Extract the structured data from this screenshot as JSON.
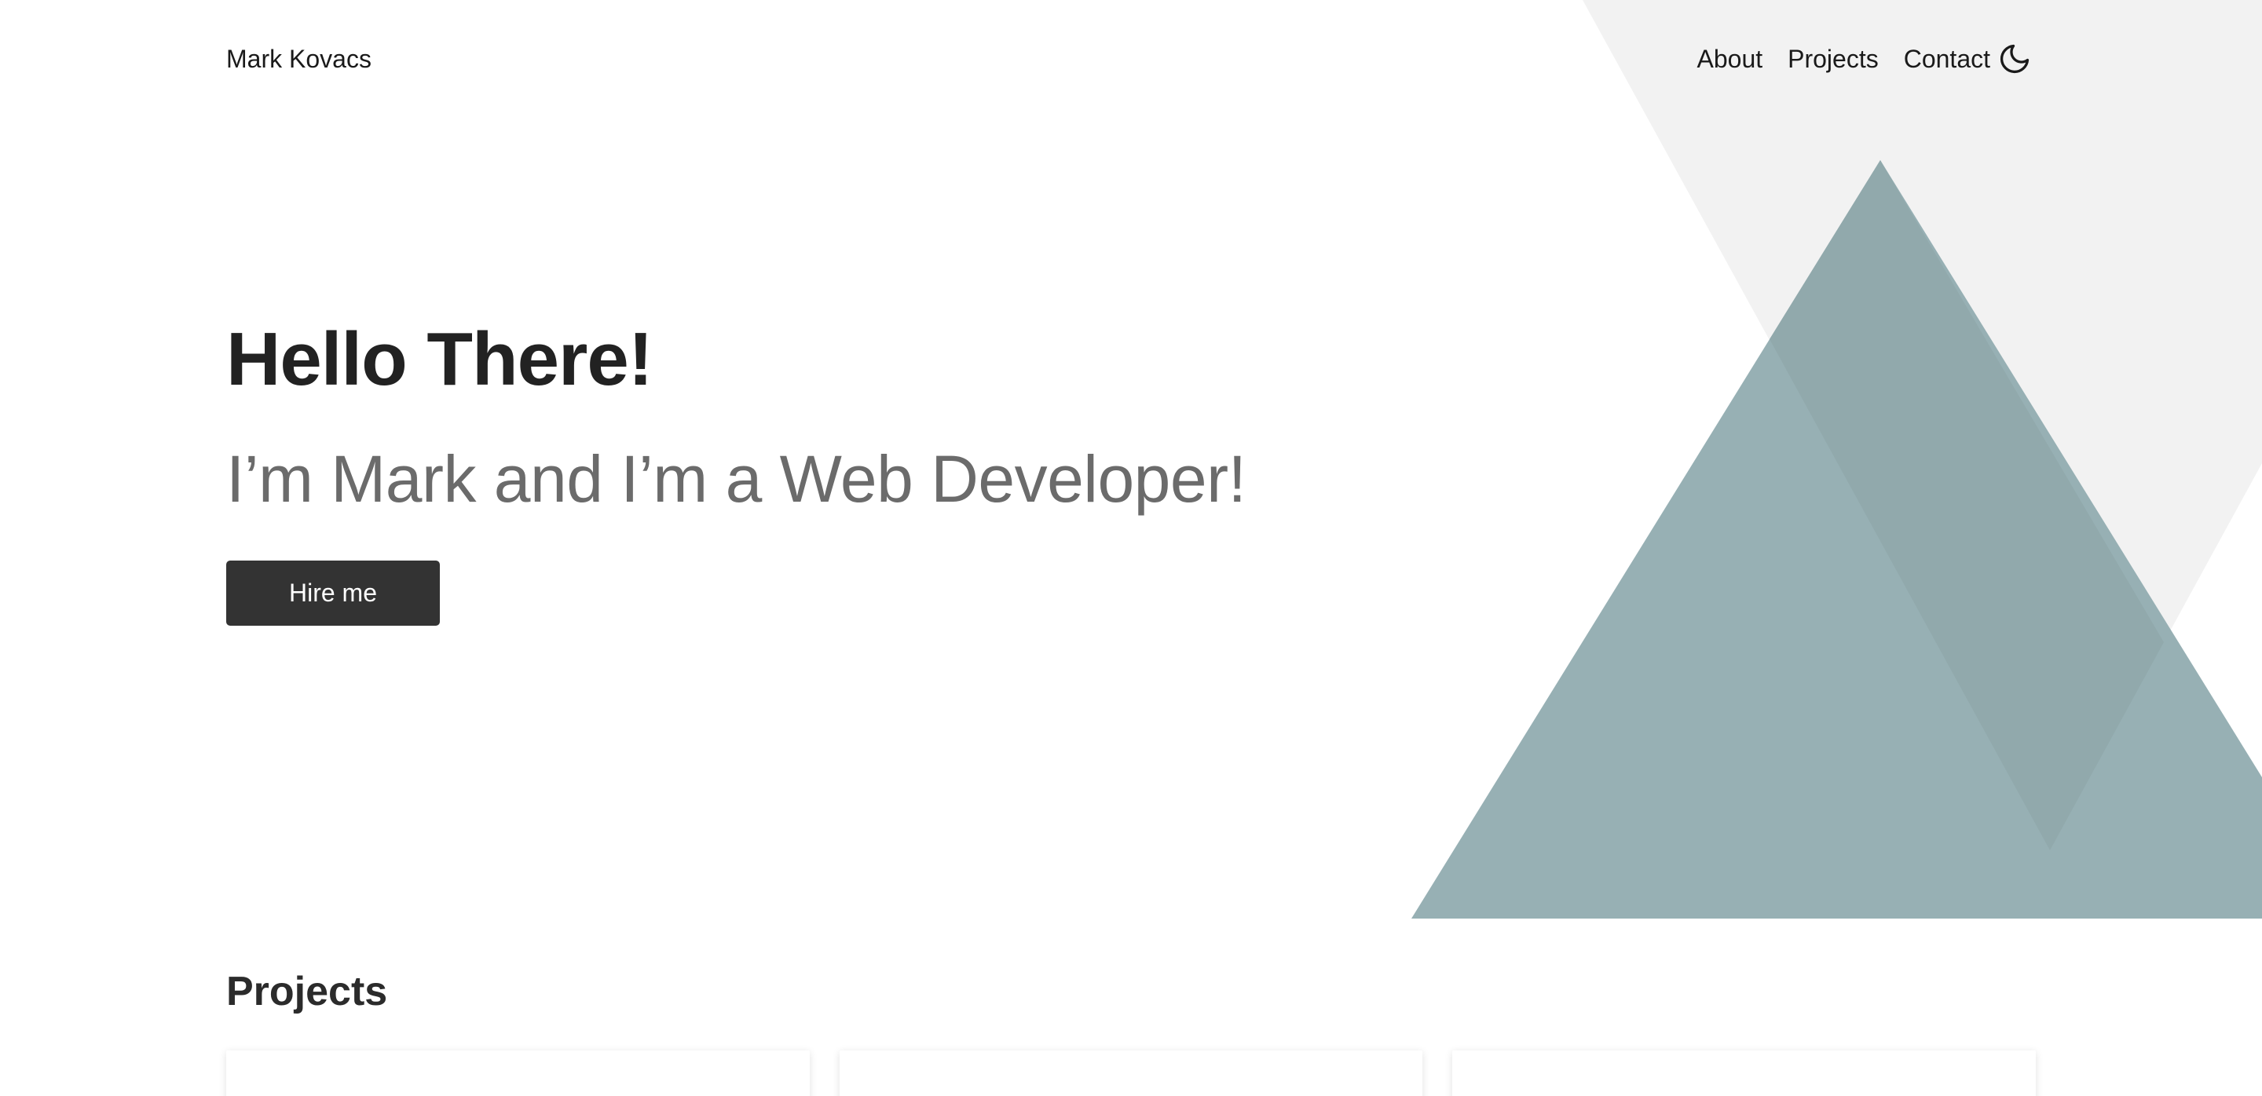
{
  "header": {
    "brand": "Mark Kovacs",
    "nav": [
      {
        "label": "About"
      },
      {
        "label": "Projects"
      },
      {
        "label": "Contact"
      }
    ],
    "theme_toggle_icon": "moon-icon"
  },
  "hero": {
    "title": "Hello There!",
    "subtitle": "I’m Mark and I’m a Web Developer!",
    "cta_label": "Hire me"
  },
  "projects": {
    "title": "Projects",
    "card_count": 3
  },
  "colors": {
    "background": "#ffffff",
    "text": "#222222",
    "subtitle": "#6b6b6b",
    "button_bg": "#333333",
    "button_text": "#ffffff",
    "shape_light": "#f2f2f2",
    "shape_teal": "#97b0b4",
    "shape_teal_dark": "#91a9ac"
  }
}
